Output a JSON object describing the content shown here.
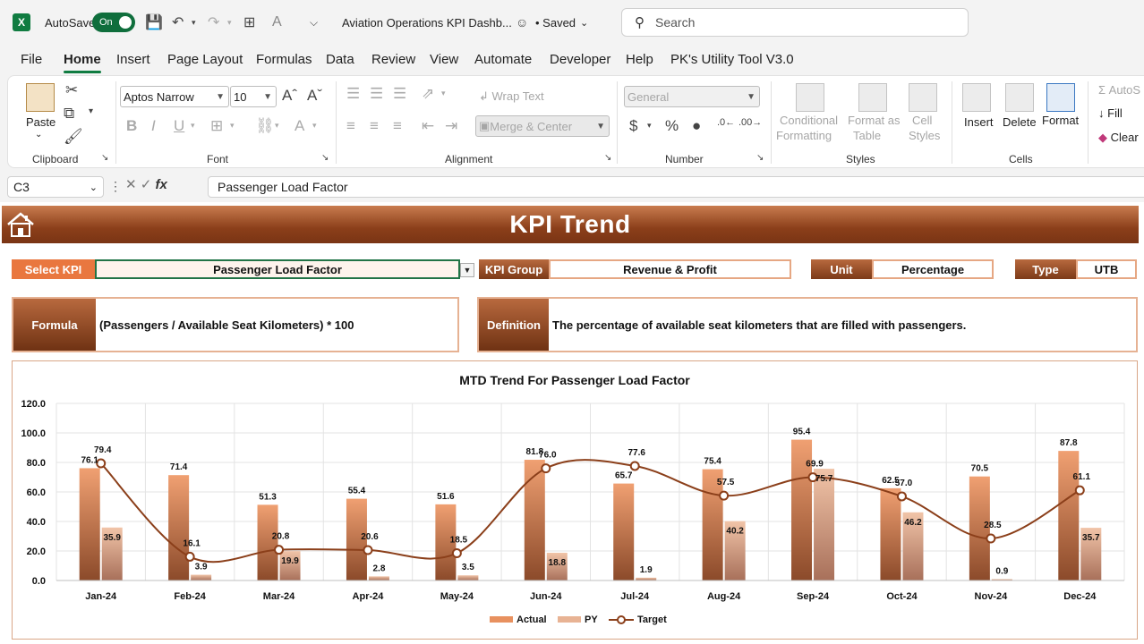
{
  "titlebar": {
    "autosave_label": "AutoSave",
    "autosave_state": "On",
    "doc_title": "Aviation Operations KPI Dashb...",
    "saved_label": "• Saved",
    "search_placeholder": "Search"
  },
  "menu": {
    "tabs": [
      "File",
      "Home",
      "Insert",
      "Page Layout",
      "Formulas",
      "Data",
      "Review",
      "View",
      "Automate",
      "Developer",
      "Help",
      "PK's Utility Tool V3.0"
    ],
    "active": "Home"
  },
  "ribbon": {
    "clipboard": {
      "label": "Clipboard",
      "paste": "Paste"
    },
    "font": {
      "label": "Font",
      "font_name": "Aptos Narrow",
      "font_size": "10"
    },
    "alignment": {
      "label": "Alignment",
      "wrap_text": "Wrap Text",
      "merge_center": "Merge & Center"
    },
    "number": {
      "label": "Number",
      "format": "General"
    },
    "styles": {
      "label": "Styles",
      "conditional_1": "Conditional",
      "conditional_2": "Formatting",
      "format_as_1": "Format as",
      "format_as_2": "Table",
      "cell_1": "Cell",
      "cell_2": "Styles"
    },
    "cells": {
      "label": "Cells",
      "insert": "Insert",
      "delete": "Delete",
      "format": "Format"
    },
    "editing": {
      "autosum": "AutoS",
      "fill": "Fill",
      "clear": "Clear"
    }
  },
  "formula_bar": {
    "name_box": "C3",
    "formula": "Passenger Load Factor"
  },
  "sheet": {
    "banner_title": "KPI Trend",
    "select_kpi_label": "Select KPI",
    "select_kpi_value": "Passenger Load Factor",
    "kpi_group_label": "KPI Group",
    "kpi_group_value": "Revenue & Profit",
    "unit_label": "Unit",
    "unit_value": "Percentage",
    "type_label": "Type",
    "type_value": "UTB",
    "formula_label": "Formula",
    "formula_value": "(Passengers / Available Seat Kilometers) * 100",
    "definition_label": "Definition",
    "definition_value": "The percentage of available seat kilometers that are filled with passengers."
  },
  "chart_data": {
    "type": "bar",
    "title": "MTD Trend For Passenger Load Factor",
    "categories": [
      "Jan-24",
      "Feb-24",
      "Mar-24",
      "Apr-24",
      "May-24",
      "Jun-24",
      "Jul-24",
      "Aug-24",
      "Sep-24",
      "Oct-24",
      "Nov-24",
      "Dec-24"
    ],
    "series": [
      {
        "name": "Actual",
        "kind": "bar",
        "color": "#e8915f",
        "values": [
          76.1,
          71.4,
          51.3,
          55.4,
          51.6,
          81.8,
          65.7,
          75.4,
          95.4,
          62.5,
          70.5,
          87.8
        ]
      },
      {
        "name": "PY",
        "kind": "bar",
        "color": "#e8b394",
        "values": [
          35.9,
          3.9,
          19.9,
          2.8,
          3.5,
          18.8,
          1.9,
          40.2,
          75.7,
          46.2,
          0.9,
          35.7
        ]
      },
      {
        "name": "Target",
        "kind": "line",
        "color": "#8b3f1a",
        "values": [
          79.4,
          16.1,
          20.8,
          20.6,
          18.5,
          76.0,
          77.6,
          57.5,
          69.9,
          57.0,
          28.5,
          61.1
        ]
      }
    ],
    "y_ticks": [
      "0.0",
      "20.0",
      "40.0",
      "60.0",
      "80.0",
      "100.0",
      "120.0"
    ],
    "ylim": [
      0,
      120
    ],
    "legend": "bottom",
    "grid": true
  }
}
